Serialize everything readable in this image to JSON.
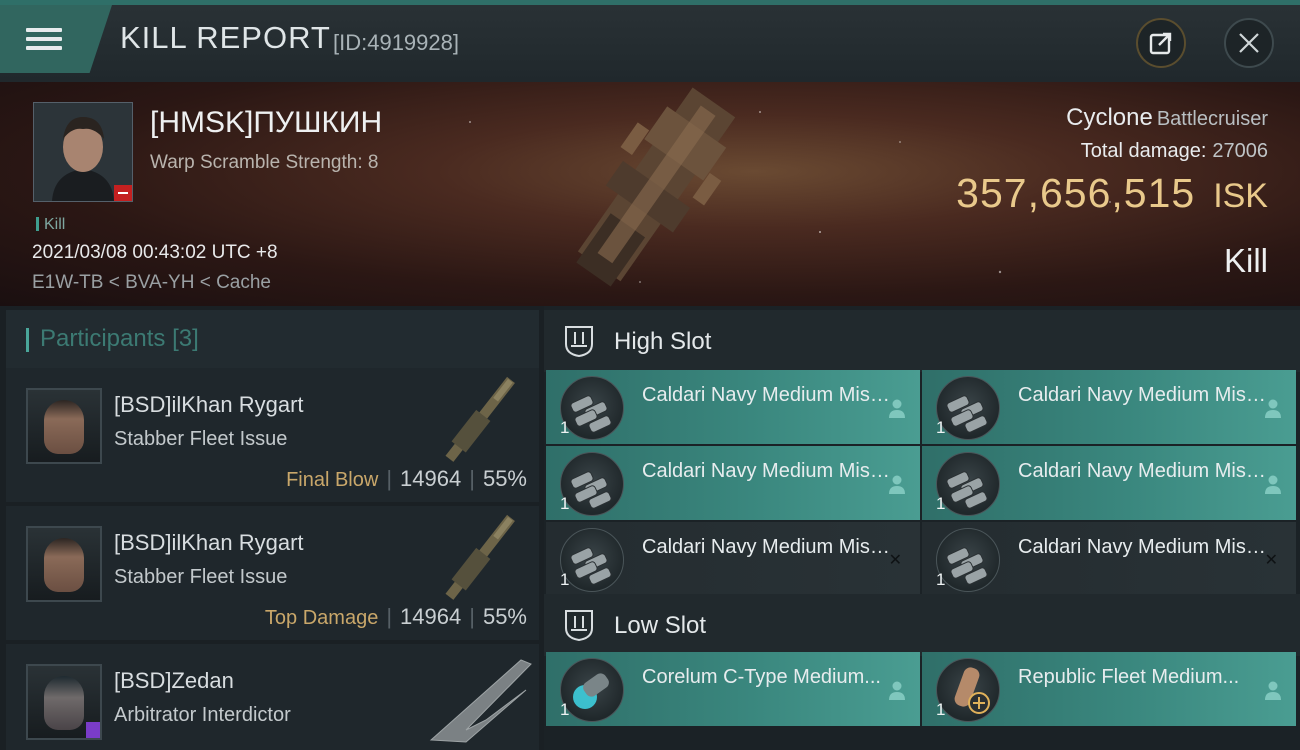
{
  "header": {
    "title": "KILL REPORT",
    "report_id": "[ID:4919928]"
  },
  "victim": {
    "name": "[HMSK]ПУШКИН",
    "warp_scramble": "Warp Scramble Strength: 8",
    "kill_tag": "Kill",
    "datetime": "2021/03/08 00:43:02 UTC +8",
    "location": "E1W-TB < BVA-YH < Cache",
    "ship_name": "Cyclone",
    "ship_class": "Battlecruiser",
    "total_damage_label": "Total damage:",
    "total_damage_value": "27006",
    "isk_value": "357,656,515",
    "isk_unit": "ISK",
    "result": "Kill"
  },
  "participants": {
    "label": "Participants",
    "count": "[3]",
    "items": [
      {
        "name": "[BSD]ilKhan Rygart",
        "ship": "Stabber Fleet Issue",
        "tag": "Final Blow",
        "damage": "14964",
        "percent": "55%"
      },
      {
        "name": "[BSD]ilKhan Rygart",
        "ship": "Stabber Fleet Issue",
        "tag": "Top Damage",
        "damage": "14964",
        "percent": "55%"
      },
      {
        "name": "[BSD]Zedan",
        "ship": "Arbitrator Interdictor"
      }
    ]
  },
  "fitting": {
    "high_slot": {
      "label": "High Slot",
      "modules": [
        {
          "name": "Caldari Navy Medium Missil...",
          "qty": "1"
        },
        {
          "name": "Caldari Navy Medium Missil...",
          "qty": "1"
        },
        {
          "name": "Caldari Navy Medium Missil...",
          "qty": "1"
        },
        {
          "name": "Caldari Navy Medium Missil...",
          "qty": "1"
        },
        {
          "name": "Caldari Navy Medium Missil...",
          "qty": "1"
        },
        {
          "name": "Caldari Navy Medium Missil...",
          "qty": "1"
        }
      ]
    },
    "low_slot": {
      "label": "Low Slot",
      "modules": [
        {
          "name": "Corelum C-Type Medium...",
          "qty": "1"
        },
        {
          "name": "Republic Fleet Medium...",
          "qty": "1"
        }
      ]
    }
  },
  "colors": {
    "accent": "#31665f",
    "isk_gold": "#e9c98b",
    "tag_gold": "#c9a76a",
    "module_teal": "#3a877e",
    "security_red": "#c42020"
  },
  "icons": {
    "menu": "hamburger-icon",
    "share": "share-icon",
    "close": "close-icon",
    "slot": "slot-icon",
    "person": "person-icon"
  }
}
